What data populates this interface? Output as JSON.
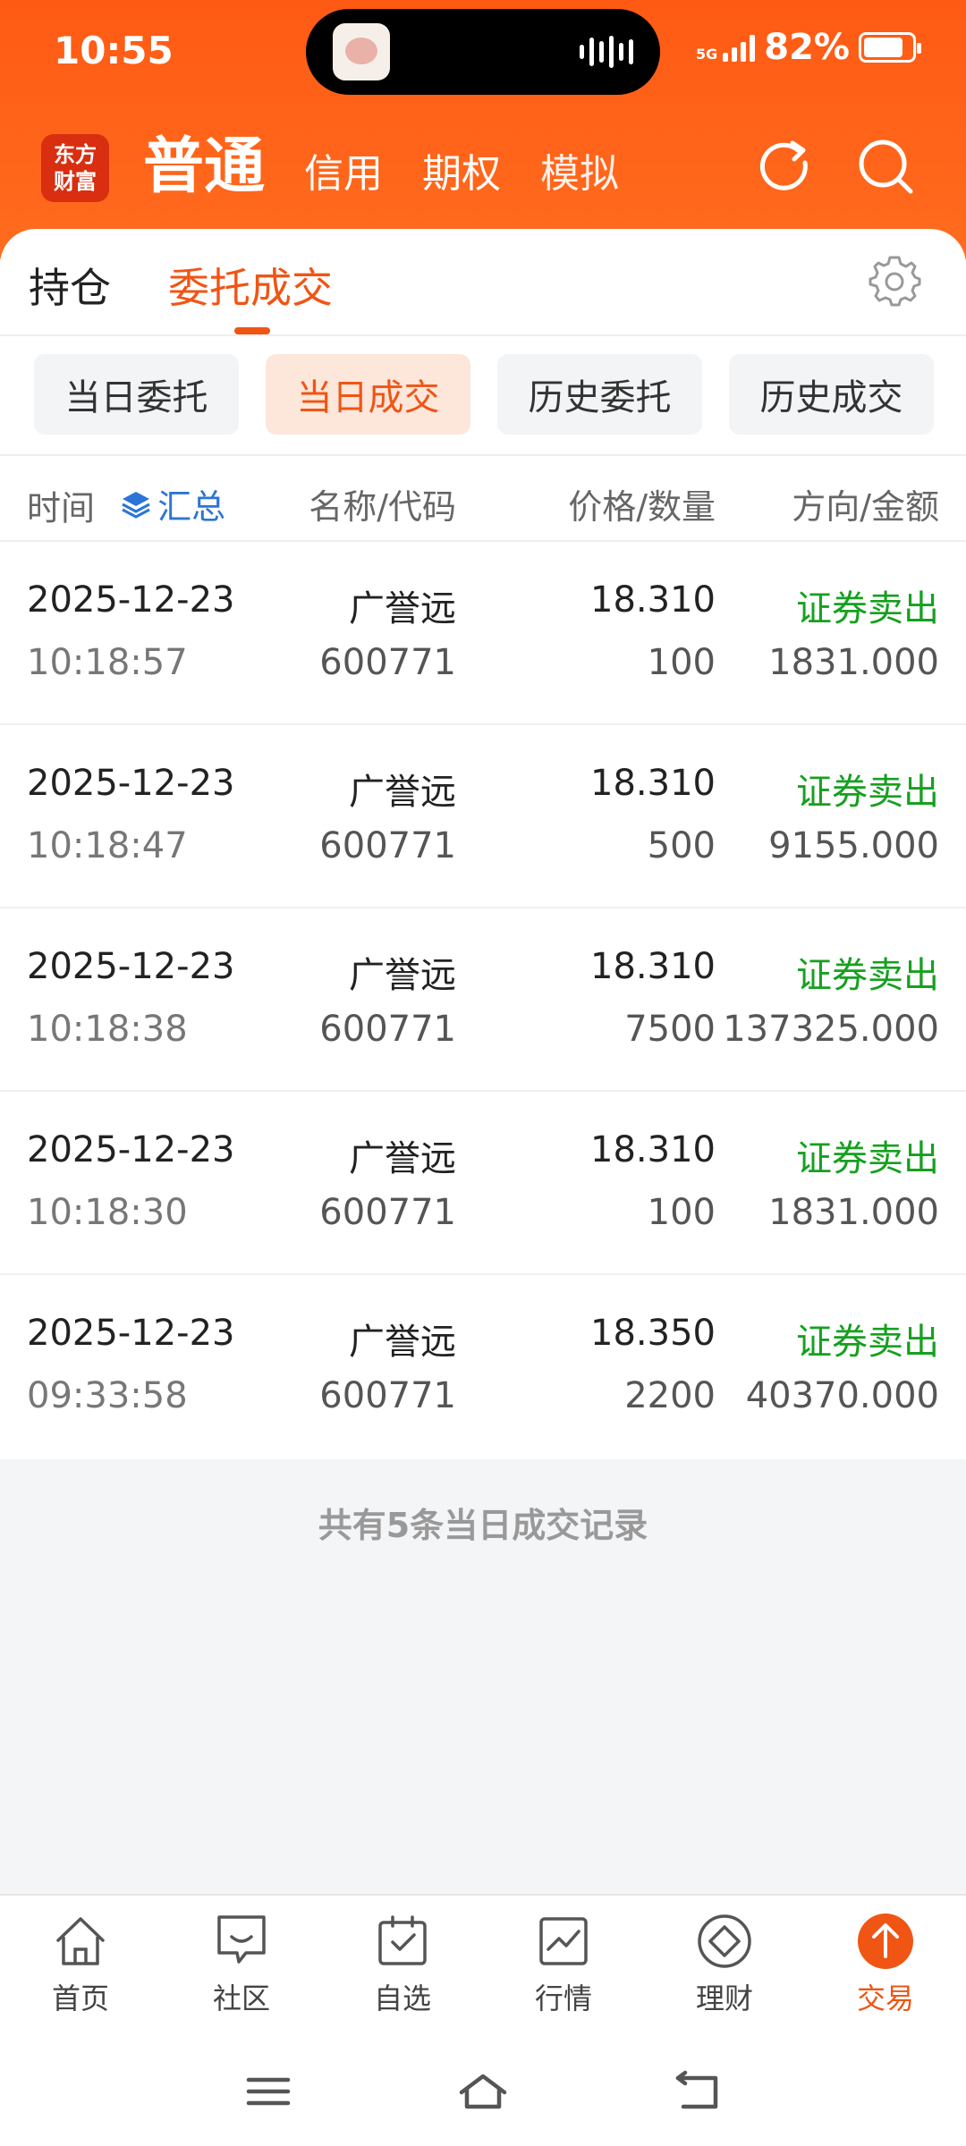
{
  "status_bar": {
    "time": "10:55",
    "network": "5G",
    "battery": "82%",
    "battery_level": 0.82
  },
  "header": {
    "logo_text": [
      "东方",
      "财富"
    ],
    "nav": [
      "普通",
      "信用",
      "期权",
      "模拟"
    ],
    "icons": [
      "refresh-icon",
      "search-icon"
    ]
  },
  "tabs": {
    "holdings": "持仓",
    "orders": "委托成交"
  },
  "segments": [
    "当日委托",
    "当日成交",
    "历史委托",
    "历史成交"
  ],
  "active_segment": "当日成交",
  "table": {
    "headers": {
      "time": "时间",
      "summary": "汇总",
      "name": "名称/代码",
      "price": "价格/数量",
      "direction": "方向/金额"
    },
    "rows": [
      {
        "date": "2025-12-23",
        "time": "10:18:57",
        "name": "广誉远",
        "code": "600771",
        "price": "18.310",
        "qty": "100",
        "direction": "证券卖出",
        "amount": "1831.000"
      },
      {
        "date": "2025-12-23",
        "time": "10:18:47",
        "name": "广誉远",
        "code": "600771",
        "price": "18.310",
        "qty": "500",
        "direction": "证券卖出",
        "amount": "9155.000"
      },
      {
        "date": "2025-12-23",
        "time": "10:18:38",
        "name": "广誉远",
        "code": "600771",
        "price": "18.310",
        "qty": "7500",
        "direction": "证券卖出",
        "amount": "137325.000"
      },
      {
        "date": "2025-12-23",
        "time": "10:18:30",
        "name": "广誉远",
        "code": "600771",
        "price": "18.310",
        "qty": "100",
        "direction": "证券卖出",
        "amount": "1831.000"
      },
      {
        "date": "2025-12-23",
        "time": "09:33:58",
        "name": "广誉远",
        "code": "600771",
        "price": "18.350",
        "qty": "2200",
        "direction": "证券卖出",
        "amount": "40370.000"
      }
    ]
  },
  "footer_note": "共有5条当日成交记录",
  "bottom_nav": [
    {
      "label": "首页",
      "icon": "home-icon"
    },
    {
      "label": "社区",
      "icon": "community-icon"
    },
    {
      "label": "自选",
      "icon": "watchlist-icon"
    },
    {
      "label": "行情",
      "icon": "market-icon"
    },
    {
      "label": "理财",
      "icon": "finance-icon"
    },
    {
      "label": "交易",
      "icon": "trade-icon"
    }
  ],
  "colors": {
    "brand": "#ff5a14",
    "accent": "#f05514",
    "sell": "#16a01f",
    "link": "#2b75d6"
  }
}
